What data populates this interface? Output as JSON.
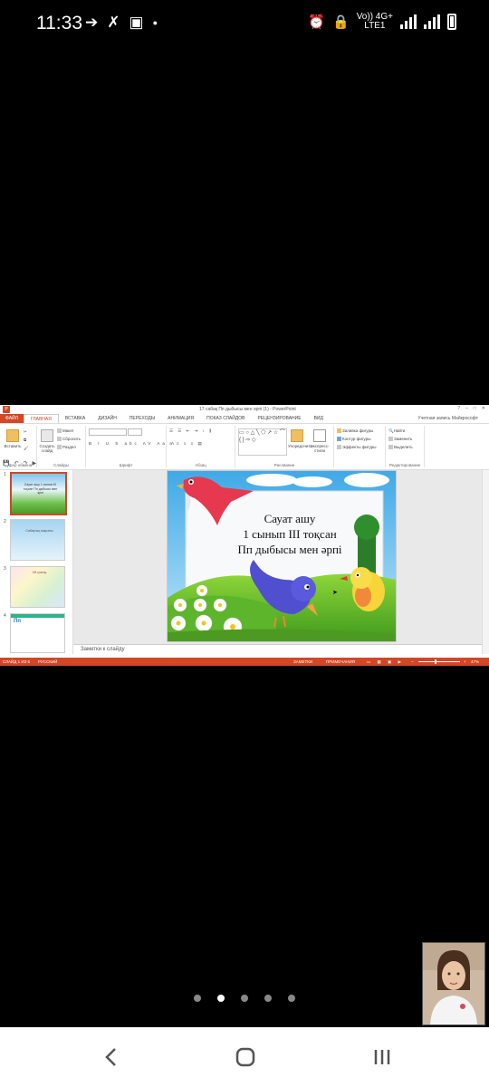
{
  "status_bar": {
    "time": "11:33",
    "volte": "Vo)) 4G+",
    "lte": "LTE1"
  },
  "powerpoint": {
    "window_title": "17 сабақ Пп дыбысы мен әрпі (1) - PowerPoint",
    "account": "Учетная запись Майкрософт",
    "tabs": {
      "file": "ФАЙЛ",
      "home": "ГЛАВНАЯ",
      "insert": "ВСТАВКА",
      "design": "ДИЗАЙН",
      "transitions": "ПЕРЕХОДЫ",
      "animations": "АНИМАЦИЯ",
      "slideshow": "ПОКАЗ СЛАЙДОВ",
      "review": "РЕЦЕНЗИРОВАНИЕ",
      "view": "ВИД"
    },
    "ribbon": {
      "paste": "Вставить",
      "clipboard": "Буфер обмена",
      "new_slide": "Создать слайд",
      "layout": "Макет",
      "reset": "Сбросить",
      "section": "Раздел",
      "slides": "Слайды",
      "font": "Шрифт",
      "paragraph": "Абзац",
      "arrange": "Упорядочить",
      "quick_styles": "Экспресс-стили",
      "drawing": "Рисование",
      "shape_fill": "Заливка фигуры",
      "shape_outline": "Контур фигуры",
      "shape_effects": "Эффекты фигуры",
      "find": "Найти",
      "replace": "Заменить",
      "select": "Выделить",
      "editing": "Редактирование"
    },
    "thumbnails": [
      {
        "num": "1",
        "text": "Сауат ашу 1 сынып III тоқсан Пп дыбысы мен әрпі"
      },
      {
        "num": "2",
        "text": "Сабақтың мақсаты"
      },
      {
        "num": "3",
        "text": "Ой қозғау"
      },
      {
        "num": "4",
        "text": "Пп"
      }
    ],
    "slide": {
      "line1": "Сауат ашу",
      "line2": "1 сынып III тоқсан",
      "line3": "Пп дыбысы мен әрпі"
    },
    "notes_placeholder": "Заметки к слайду",
    "statusbar": {
      "slide_info": "СЛАЙД 1 ИЗ 6",
      "language": "РУССКИЙ",
      "notes": "ЗАМЕТКИ",
      "comments": "ПРИМЕЧАНИЯ",
      "zoom": "47%"
    }
  },
  "pager": {
    "count": 5,
    "active_index": 1
  }
}
